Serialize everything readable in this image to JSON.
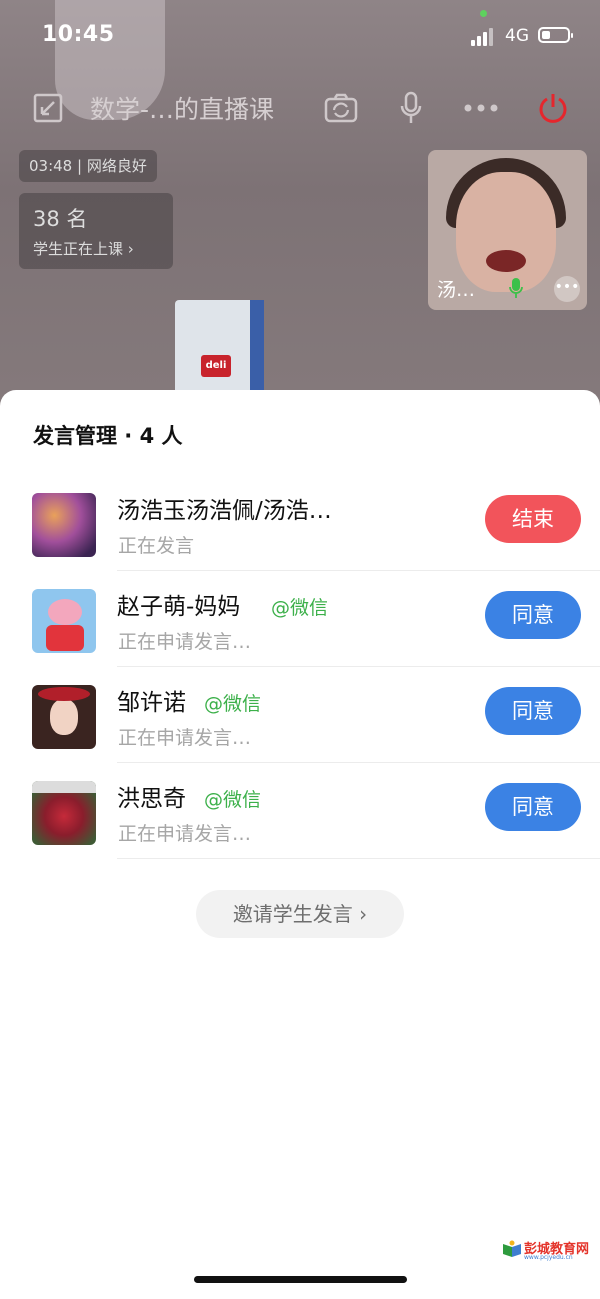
{
  "status_bar": {
    "time": "10:45",
    "network": "4G"
  },
  "toolbar": {
    "title": "数学-…的直播课"
  },
  "session": {
    "timer_status": "03:48 | 网络良好",
    "student_count": "38 名",
    "student_status": "学生正在上课 ›"
  },
  "video_tile": {
    "name": "汤…"
  },
  "panel": {
    "title": "发言管理 · 4 人",
    "items": [
      {
        "name": "汤浩玉汤浩佩/汤浩…",
        "tag": "",
        "status": "正在发言",
        "action": "结束",
        "action_type": "end"
      },
      {
        "name": "赵子萌-妈妈",
        "tag": "@微信",
        "status": "正在申请发言…",
        "action": "同意",
        "action_type": "approve"
      },
      {
        "name": "邹许诺",
        "tag": "@微信",
        "status": "正在申请发言…",
        "action": "同意",
        "action_type": "approve"
      },
      {
        "name": "洪思奇",
        "tag": "@微信",
        "status": "正在申请发言…",
        "action": "同意",
        "action_type": "approve"
      }
    ],
    "invite": "邀请学生发言 ›"
  },
  "watermark": {
    "text": "彭城教育网",
    "url": "www.pcjyedu.cn"
  },
  "colors": {
    "end": "#f2545b",
    "approve": "#3b82e4",
    "wechat_tag": "#3cb04a",
    "hangup": "#e5262d"
  }
}
